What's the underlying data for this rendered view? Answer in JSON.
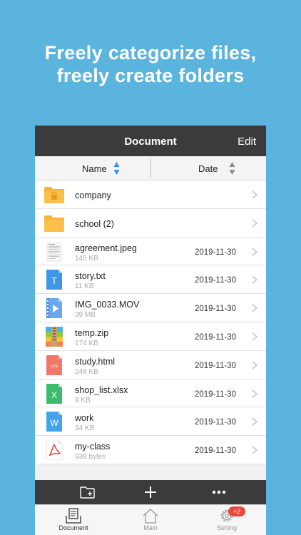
{
  "headline": {
    "line1": "Freely categorize files,",
    "line2": "freely create folders"
  },
  "navbar": {
    "title": "Document",
    "edit_label": "Edit"
  },
  "sort": {
    "name_label": "Name",
    "date_label": "Date"
  },
  "files": [
    {
      "name": "company",
      "icon": "locked-folder-icon"
    },
    {
      "name": "school (2)",
      "icon": "folder-icon"
    },
    {
      "name": "agreement.jpeg",
      "size": "145 KB",
      "date": "2019-11-30",
      "icon": "image-file-icon"
    },
    {
      "name": "story.txt",
      "size": "11 KB",
      "date": "2019-11-30",
      "icon": "text-file-icon",
      "color": "#3f95e6",
      "glyph": "T"
    },
    {
      "name": "IMG_0033.MOV",
      "size": "39 MB",
      "date": "2019-11-30",
      "icon": "video-file-icon",
      "color": "#6aa9f0"
    },
    {
      "name": "temp.zip",
      "size": "174 KB",
      "date": "2019-11-30",
      "icon": "zip-file-icon"
    },
    {
      "name": "study.html",
      "size": "248 KB",
      "date": "2019-11-30",
      "icon": "html-file-icon",
      "color": "#f1776b",
      "glyph": "</>"
    },
    {
      "name": "shop_list.xlsx",
      "size": "9 KB",
      "date": "2019-11-30",
      "icon": "excel-file-icon",
      "color": "#3dbb6c",
      "glyph": "X"
    },
    {
      "name": "work",
      "size": "34 KB",
      "date": "2019-11-30",
      "icon": "word-file-icon",
      "color": "#47a3e8",
      "glyph": "W"
    },
    {
      "name": "my-class",
      "size": "938 bytes",
      "date": "2019-11-30",
      "icon": "pdf-file-icon",
      "color": "#ffffff",
      "glyph": ""
    }
  ],
  "toolbar": {
    "new_folder_icon": "new-folder-icon",
    "add_icon": "plus-icon",
    "more_icon": "more-icon"
  },
  "tabs": {
    "document": "Document",
    "main": "Main",
    "setting": "Setting",
    "setting_badge": "+2"
  },
  "colors": {
    "background": "#5bb4de",
    "dark_bar": "#3b3b3b",
    "sort_arrow_blue": "#3d8ee8",
    "folder": "#f7b43b",
    "badge": "#e8483b"
  }
}
